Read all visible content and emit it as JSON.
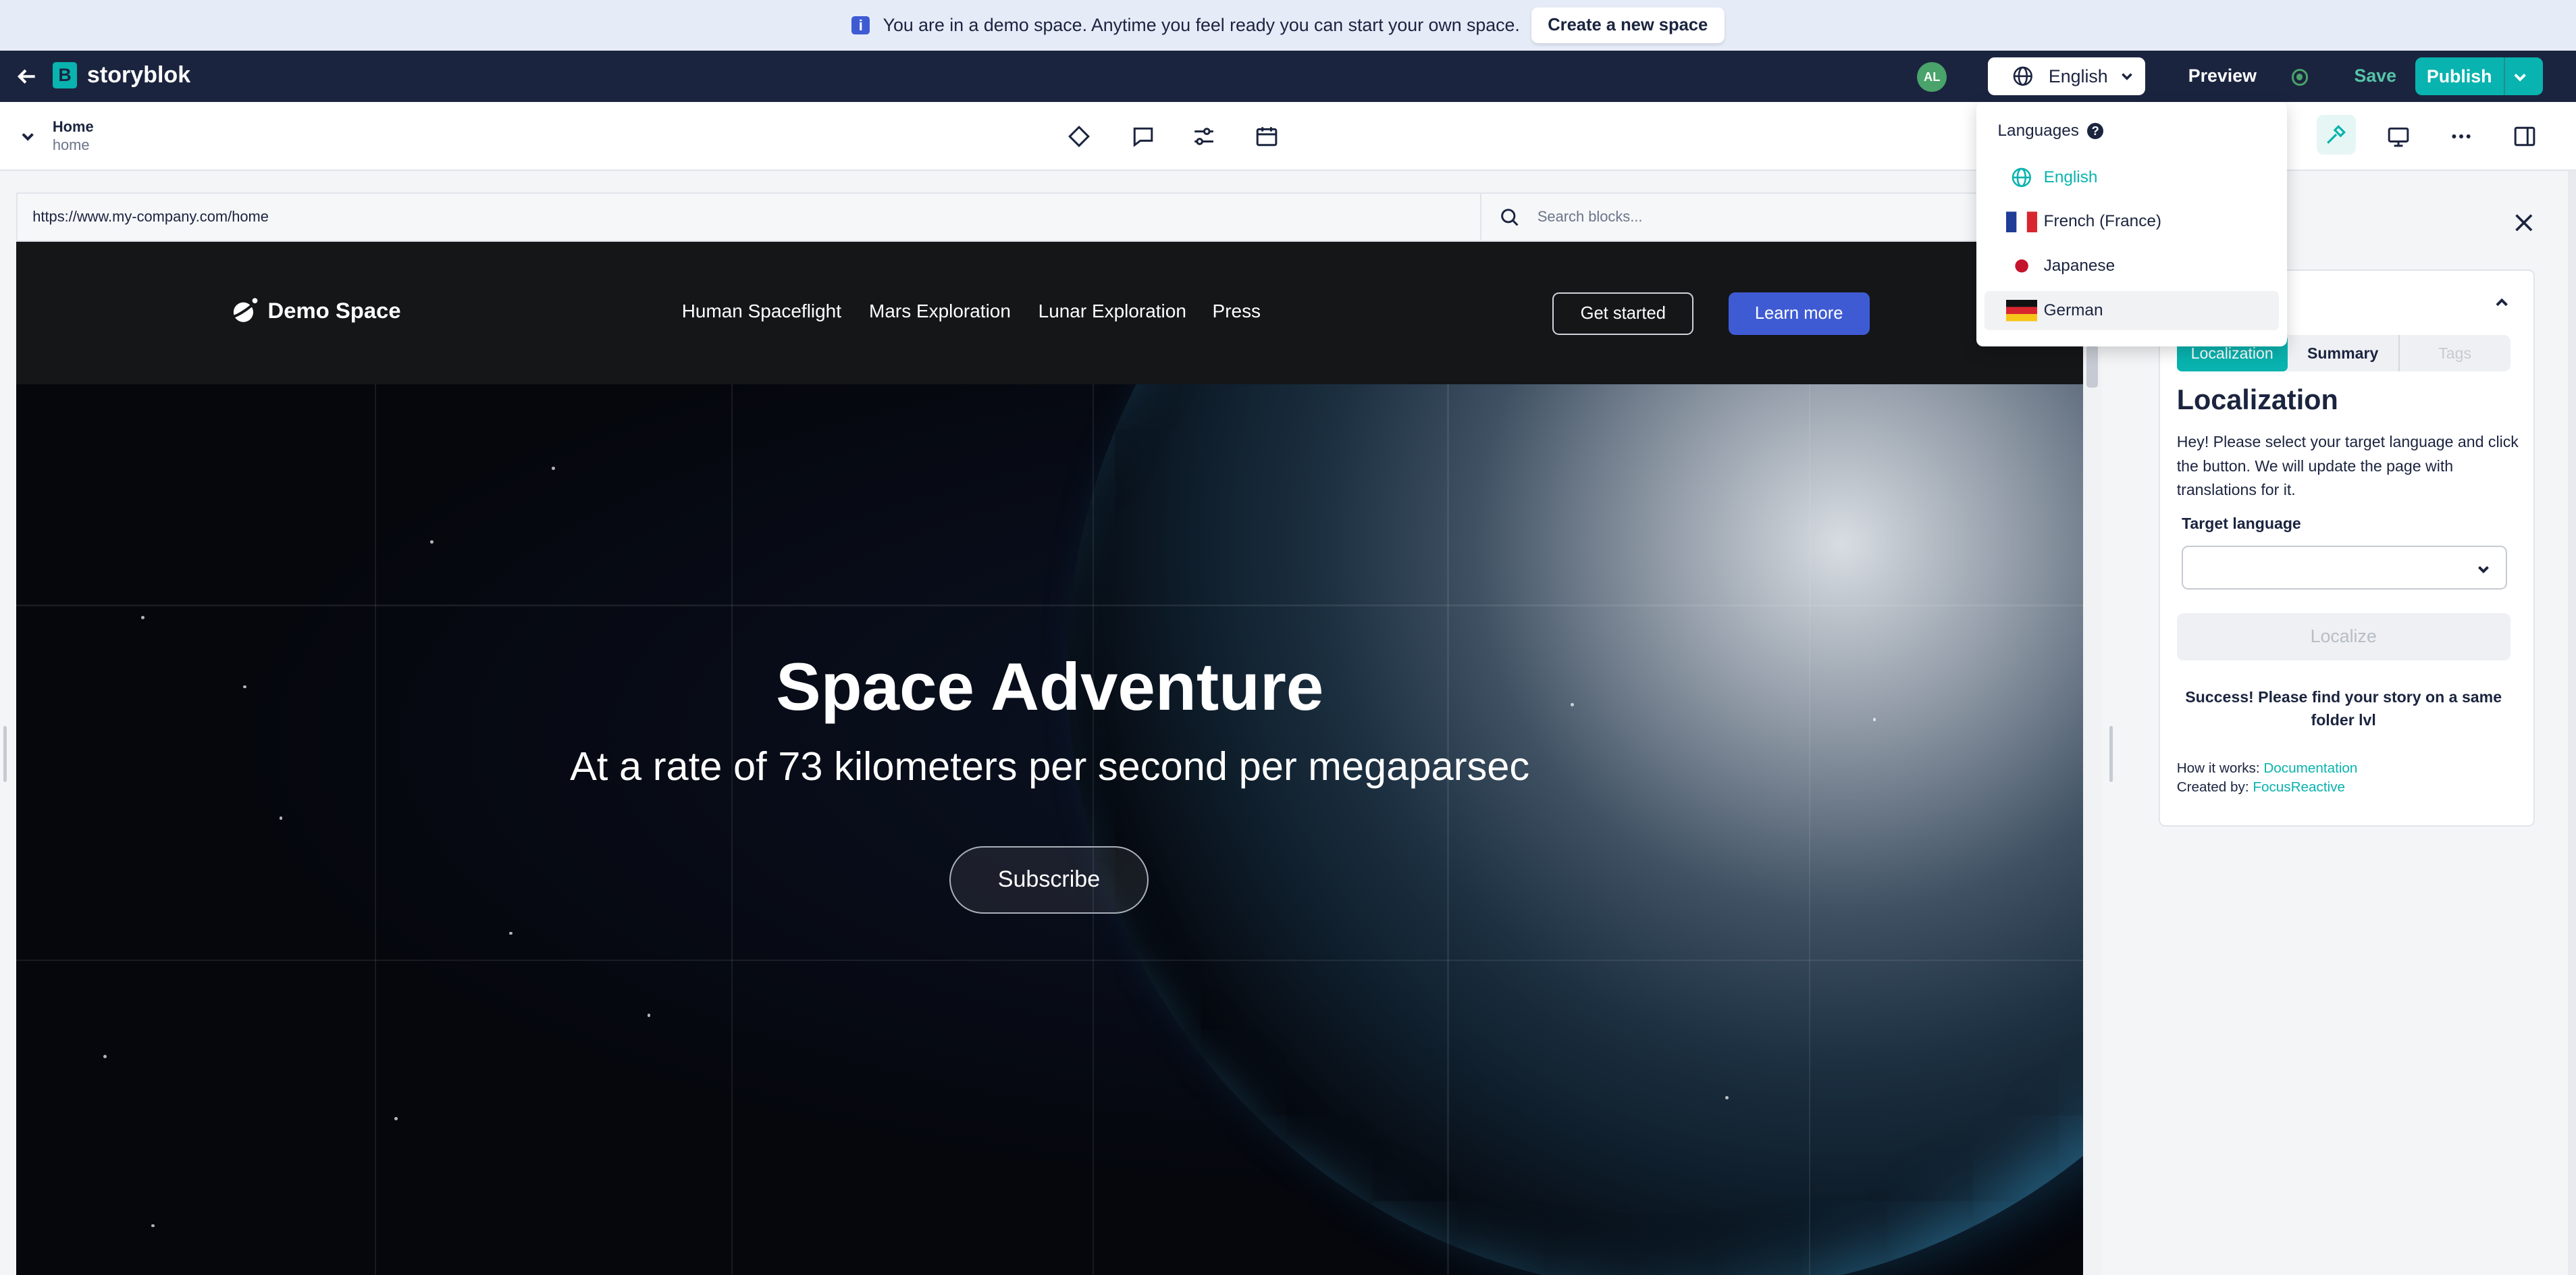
{
  "banner": {
    "info_icon": "i",
    "message": "You are in a demo space. Anytime you feel ready you can start your own space.",
    "cta": "Create a new space"
  },
  "topbar": {
    "brand": "storyblok",
    "brand_mark": "B",
    "avatar_initials": "AL",
    "language": "English",
    "preview": "Preview",
    "save": "Save",
    "publish": "Publish"
  },
  "toolbar": {
    "story_name": "Home",
    "story_slug": "home"
  },
  "url_bar": {
    "url": "https://www.my-company.com/home",
    "search_placeholder": "Search blocks..."
  },
  "site": {
    "logo": "Demo Space",
    "nav": [
      "Human Spaceflight",
      "Mars Exploration",
      "Lunar Exploration",
      "Press"
    ],
    "get_started": "Get started",
    "learn_more": "Learn more",
    "hero_title": "Space Adventure",
    "hero_subtitle": "At a rate of 73 kilometers per second per megaparsec",
    "subscribe": "Subscribe"
  },
  "panel": {
    "tabs": [
      "Localization",
      "Summary",
      "Tags"
    ],
    "title": "Localization",
    "description": "Hey! Please select your target language and click the button. We will update the page with translations for it.",
    "target_label": "Target language",
    "target_value": "",
    "localize": "Localize",
    "success": "Success! Please find your story on a same folder lvl",
    "how_label": "How it works: ",
    "how_link": "Documentation",
    "created_label": "Created by: ",
    "created_link": "FocusReactive"
  },
  "languages": {
    "title": "Languages",
    "help": "?",
    "items": [
      {
        "label": "English",
        "icon": "globe-icon"
      },
      {
        "label": "French (France)",
        "icon": "flag-france-icon"
      },
      {
        "label": "Japanese",
        "icon": "flag-japan-icon"
      },
      {
        "label": "German",
        "icon": "flag-germany-icon"
      }
    ],
    "selected": "English",
    "hovered": "German"
  },
  "colors": {
    "navy": "#1b243f",
    "teal": "#09b3af",
    "indigo": "#3f5bd4",
    "banner": "#e6ebf8"
  }
}
